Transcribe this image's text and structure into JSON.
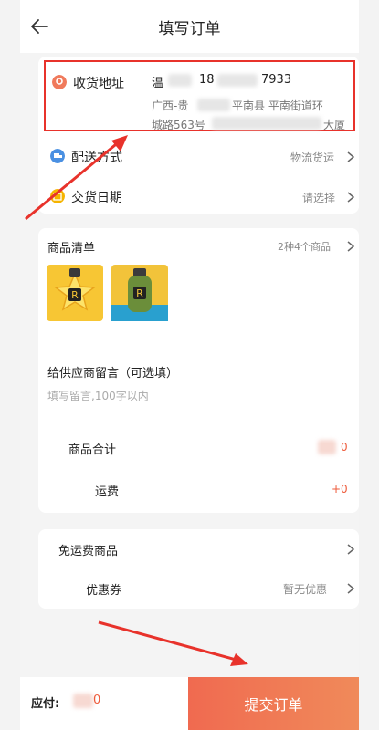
{
  "header": {
    "title": "填写订单"
  },
  "address": {
    "label": "收货地址",
    "name": "温",
    "phone_prefix": "18",
    "phone_suffix": "7933",
    "line1_a": "广西-贵",
    "line1_b": "平南县 平南街道环",
    "line2_a": "城路563号",
    "line2_b": "大厦"
  },
  "delivery": {
    "label": "配送方式",
    "value": "物流货运"
  },
  "date": {
    "label": "交货日期",
    "value": "请选择"
  },
  "goods": {
    "title": "商品清单",
    "summary": "2种4个商品",
    "thumb_label": "R"
  },
  "message": {
    "title": "给供应商留言（可选填）",
    "placeholder": "填写留言,100字以内"
  },
  "totals": {
    "goods_total_label": "商品合计",
    "goods_total_value": "0",
    "shipping_label": "运费",
    "shipping_value": "+0"
  },
  "fees": {
    "free_shipping_label": "免运费商品",
    "coupon_label": "优惠券",
    "coupon_value": "暂无优惠"
  },
  "footer": {
    "pay_label": "应付:",
    "pay_amount": "0",
    "submit_label": "提交订单"
  },
  "colors": {
    "accent": "#f06a50",
    "highlight": "#e8322b",
    "price": "#ee5a3a"
  }
}
